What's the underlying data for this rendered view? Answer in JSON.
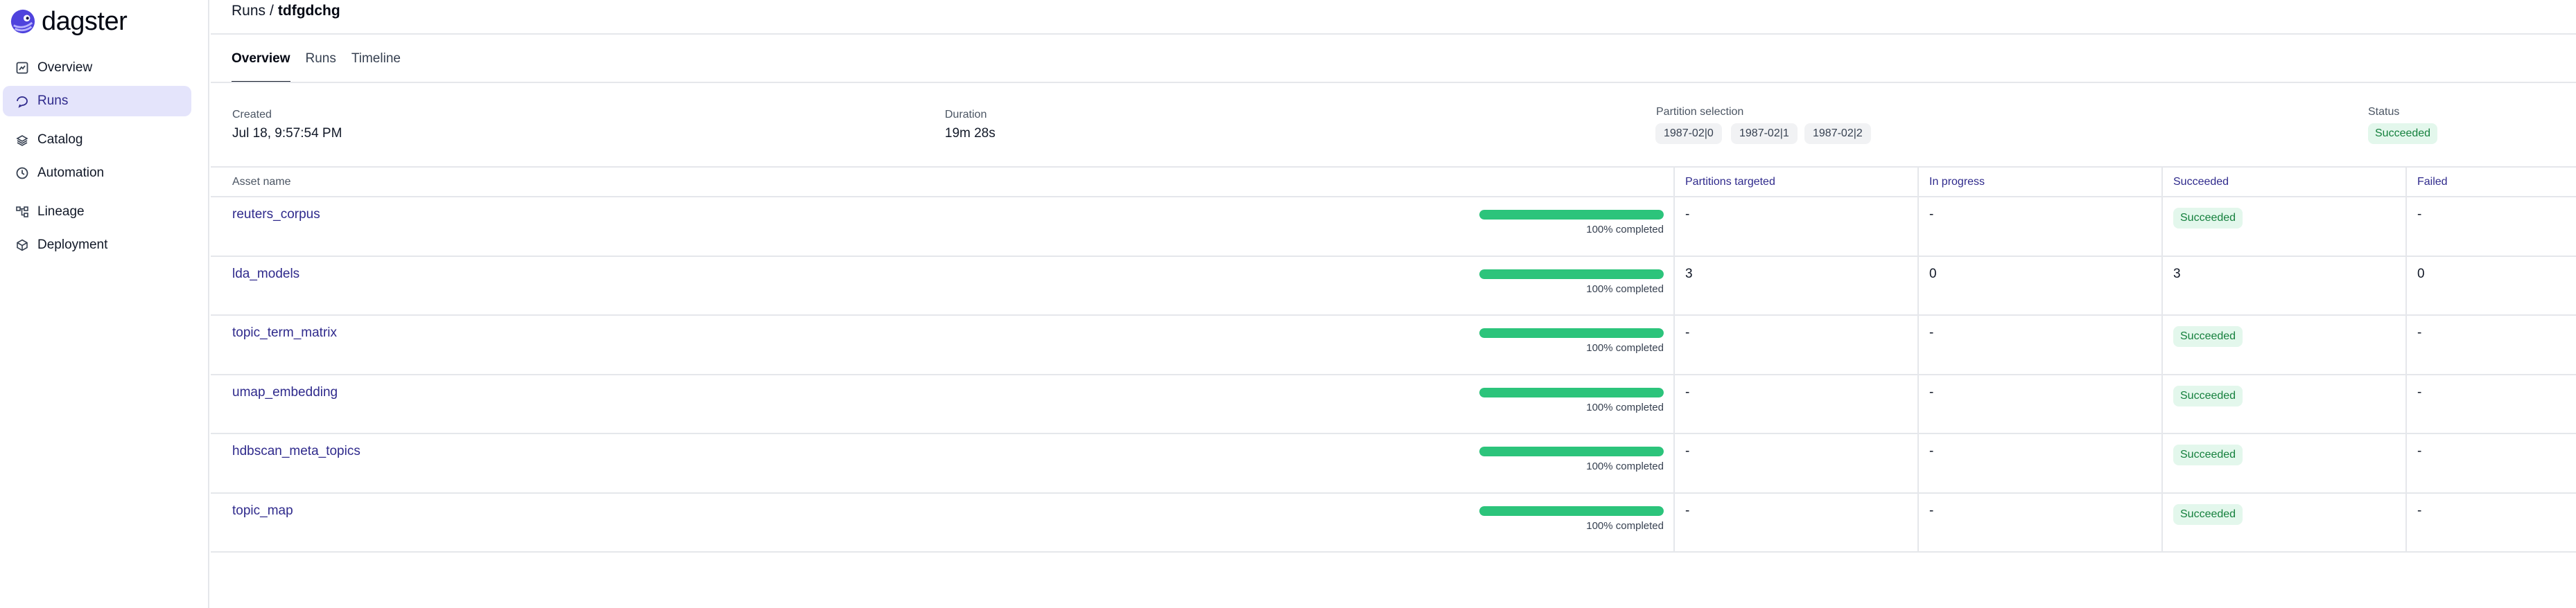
{
  "app": {
    "logo_text": "dagster"
  },
  "sidebar": {
    "items": [
      {
        "label": "Overview",
        "icon": "dashboard-icon",
        "active": false
      },
      {
        "label": "Runs",
        "icon": "runs-icon",
        "active": true
      },
      {
        "label": "Catalog",
        "icon": "catalog-icon",
        "active": false
      },
      {
        "label": "Automation",
        "icon": "clock-icon",
        "active": false
      },
      {
        "label": "Lineage",
        "icon": "lineage-icon",
        "active": false
      },
      {
        "label": "Deployment",
        "icon": "deployment-icon",
        "active": false
      }
    ]
  },
  "header": {
    "breadcrumb_link": "Runs",
    "separator": "/",
    "run_id": "tdfgdchg"
  },
  "tabs": [
    {
      "label": "Overview",
      "active": true
    },
    {
      "label": "Runs",
      "active": false
    },
    {
      "label": "Timeline",
      "active": false
    }
  ],
  "summary": {
    "created_label": "Created",
    "created_value": "Jul 18, 9:57:54 PM",
    "duration_label": "Duration",
    "duration_value": "19m 28s",
    "partition_label": "Partition selection",
    "partitions": [
      "1987-02|0",
      "1987-02|1",
      "1987-02|2"
    ],
    "status_label": "Status",
    "status_value": "Succeeded"
  },
  "table": {
    "columns": [
      "Asset name",
      "Partitions targeted",
      "In progress",
      "Succeeded",
      "Failed"
    ],
    "rows": [
      {
        "asset": "reuters_corpus",
        "progress": 1.0,
        "progress_text": "100% completed",
        "targeted": "-",
        "in_progress": "-",
        "succeeded": "Succeeded",
        "succeeded_is_tag": true,
        "failed": "-"
      },
      {
        "asset": "lda_models",
        "progress": 1.0,
        "progress_text": "100% completed",
        "targeted": "3",
        "in_progress": "0",
        "succeeded": "3",
        "succeeded_is_tag": false,
        "failed": "0"
      },
      {
        "asset": "topic_term_matrix",
        "progress": 1.0,
        "progress_text": "100% completed",
        "targeted": "-",
        "in_progress": "-",
        "succeeded": "Succeeded",
        "succeeded_is_tag": true,
        "failed": "-"
      },
      {
        "asset": "umap_embedding",
        "progress": 1.0,
        "progress_text": "100% completed",
        "targeted": "-",
        "in_progress": "-",
        "succeeded": "Succeeded",
        "succeeded_is_tag": true,
        "failed": "-"
      },
      {
        "asset": "hdbscan_meta_topics",
        "progress": 1.0,
        "progress_text": "100% completed",
        "targeted": "-",
        "in_progress": "-",
        "succeeded": "Succeeded",
        "succeeded_is_tag": true,
        "failed": "-"
      },
      {
        "asset": "topic_map",
        "progress": 1.0,
        "progress_text": "100% completed",
        "targeted": "-",
        "in_progress": "-",
        "succeeded": "Succeeded",
        "succeeded_is_tag": true,
        "failed": "-"
      }
    ]
  },
  "colors": {
    "accent": "#2f2a8c",
    "success": "#2cc47b",
    "success_text": "#15803d",
    "active_nav_bg": "#e4e4fb"
  }
}
